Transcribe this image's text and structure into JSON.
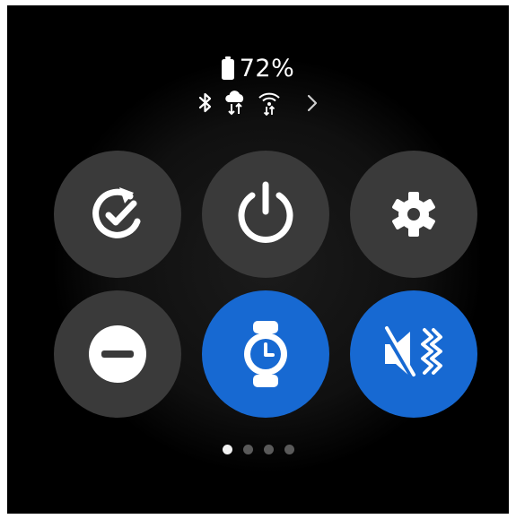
{
  "status": {
    "battery_percent": "72%",
    "battery_icon": "battery-icon",
    "connectivity_icons": [
      "bluetooth-icon",
      "cloud-sync-icon",
      "wifi-icon"
    ],
    "more_icon": "chevron-right-icon"
  },
  "quick_settings": [
    {
      "name": "sync-check-tile",
      "icon": "sync-check-icon",
      "active": false
    },
    {
      "name": "power-tile",
      "icon": "power-icon",
      "active": false
    },
    {
      "name": "settings-tile",
      "icon": "gear-icon",
      "active": false
    },
    {
      "name": "do-not-disturb-tile",
      "icon": "minus-circle-icon",
      "active": false
    },
    {
      "name": "watch-face-tile",
      "icon": "watch-icon",
      "active": true
    },
    {
      "name": "sound-vibrate-tile",
      "icon": "vibrate-mute-icon",
      "active": true
    }
  ],
  "colors": {
    "active_tile": "#1769d2",
    "inactive_tile": "#3a3a3a",
    "background": "#000000"
  },
  "pagination": {
    "total_pages": 4,
    "current_page": 1
  }
}
